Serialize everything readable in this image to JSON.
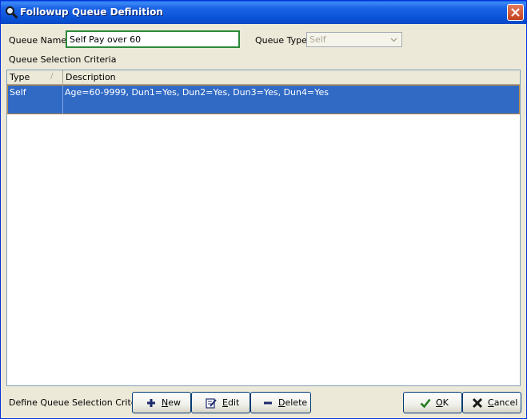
{
  "window": {
    "title": "Followup Queue Definition",
    "icon": "search-app-icon"
  },
  "form": {
    "queue_name_label": "Queue Name",
    "queue_name_value": "Self Pay over 60",
    "queue_type_label": "Queue Type",
    "queue_type_value": "Self",
    "criteria_label": "Queue Selection Criteria"
  },
  "grid": {
    "columns": [
      "Type",
      "Description"
    ],
    "sort_indicator": "/",
    "rows": [
      {
        "type": "Self",
        "description": "Age=60-9999, Dun1=Yes, Dun2=Yes, Dun3=Yes, Dun4=Yes",
        "selected": true
      }
    ]
  },
  "footer": {
    "define_label": "Define Queue Selection Criteria",
    "new_first": "N",
    "new_rest": "ew",
    "edit_first": "E",
    "edit_rest": "dit",
    "delete_first": "D",
    "delete_rest": "elete",
    "ok_first": "O",
    "ok_rest": "K",
    "cancel_first": "C",
    "cancel_rest": "ancel"
  },
  "colors": {
    "title_bar": "#0A5FE8",
    "selection": "#316AC5",
    "input_border": "#2B8A3A",
    "window_bg": "#ECE9D8"
  }
}
